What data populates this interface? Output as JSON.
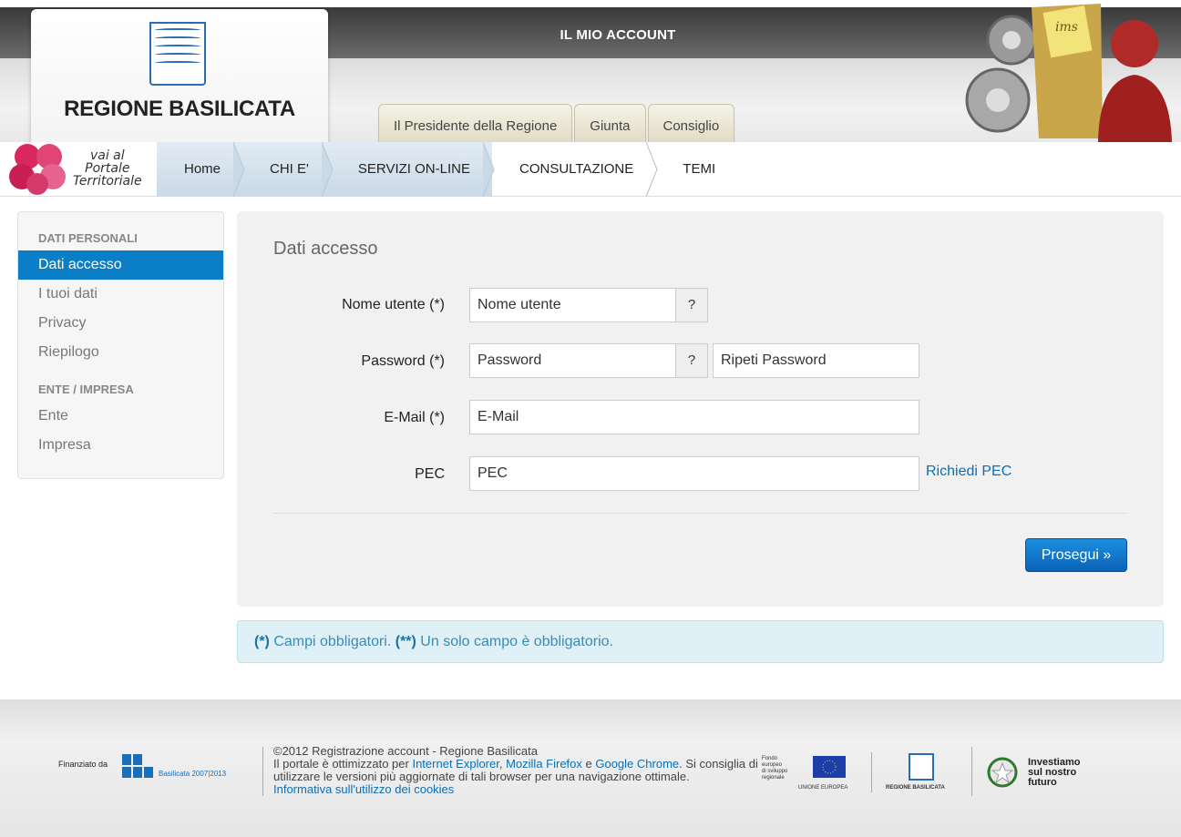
{
  "header": {
    "title": "IL MIO ACCOUNT",
    "logo_text": "REGIONE BASILICATA",
    "tabs": [
      {
        "label": "Il Presidente della Regione"
      },
      {
        "label": "Giunta"
      },
      {
        "label": "Consiglio"
      }
    ],
    "ims_label": "ims"
  },
  "nav": {
    "portale": [
      "vai al",
      "Portale",
      "Territoriale"
    ],
    "items": [
      {
        "label": "Home",
        "style": "blue"
      },
      {
        "label": "CHI E'",
        "style": "blue"
      },
      {
        "label": "SERVIZI ON-LINE",
        "style": "blue"
      },
      {
        "label": "CONSULTAZIONE",
        "style": "white"
      },
      {
        "label": "TEMI",
        "style": "white"
      }
    ]
  },
  "sidebar": {
    "sections": [
      {
        "heading": "DATI PERSONALI",
        "items": [
          "Dati accesso",
          "I tuoi dati",
          "Privacy",
          "Riepilogo"
        ]
      },
      {
        "heading": "ENTE / IMPRESA",
        "items": [
          "Ente",
          "Impresa"
        ]
      }
    ],
    "active": "Dati accesso"
  },
  "form": {
    "title": "Dati accesso",
    "username_label": "Nome utente (*)",
    "username_placeholder": "Nome utente",
    "password_label": "Password (*)",
    "password_placeholder": "Password",
    "repeat_password_placeholder": "Ripeti Password",
    "email_label": "E-Mail (*)",
    "email_placeholder": "E-Mail",
    "pec_label": "PEC",
    "pec_placeholder": "PEC",
    "help_label": "?",
    "pec_link": "Richiedi PEC",
    "submit_label": "Prosegui »"
  },
  "note": {
    "mark1": "(*)",
    "text1": " Campi obbligatori. ",
    "mark2": "(**)",
    "text2": " Un solo campo è obbligatorio."
  },
  "footer": {
    "financed_by": "Finanziato da",
    "fesr_sub": "Basilicata 2007|2013",
    "copyright": "©2012 Registrazione account - Regione Basilicata",
    "optimized_pre": "Il portale è ottimizzato per ",
    "browser_ie": "Internet Explorer",
    "comma": ", ",
    "browser_ff": "Mozilla Firefox",
    "and": " e ",
    "browser_chrome": "Google Chrome",
    "optimized_post": ". Si consiglia di utilizzare le versioni più aggiornate di tali browser per una navigazione ottimale.",
    "cookies_link": "Informativa sull'utilizzo dei cookies",
    "fondo": [
      "Fondo",
      "europeo",
      "di sviluppo",
      "regionale"
    ],
    "eu": "UNIONE EUROPEA",
    "regione": "REGIONE BASILICATA",
    "invest": [
      "Investiamo",
      "sul nostro",
      "futuro"
    ]
  },
  "colors": {
    "accent": "#0a7fc8",
    "link": "#0a6fb7",
    "note_bg": "#dff0f7"
  }
}
